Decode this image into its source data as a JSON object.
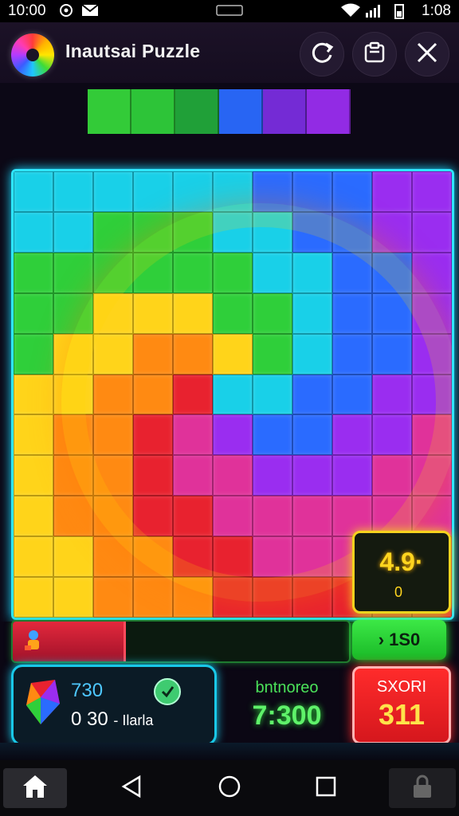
{
  "status_bar": {
    "time_left": "10:00",
    "time_right": "1:08"
  },
  "app": {
    "title": "Inautsai Puzzle"
  },
  "stats": {
    "score_card_value": "4.9·",
    "score_card_sub": "0",
    "progress_fraction": 0.33,
    "next_button_label": "› 1S0",
    "info_top": "730",
    "info_bottom_value": "0 30",
    "info_bottom_label": "- Ilarla",
    "mid_label": "bntnoreo",
    "mid_value": "7:300",
    "score_box_label": "SXORI",
    "score_box_value": "311"
  },
  "palette": {
    "red": "#e8222f",
    "orange": "#ff8a12",
    "yellow": "#ffd41a",
    "green": "#2fcf3a",
    "cyan": "#19d0e8",
    "blue": "#2a6bff",
    "purple": "#9a2df0",
    "magenta": "#e0329a",
    "board_border": "#2ee6ff",
    "next_green": "#3ce846",
    "score_red": "#ff2b2b"
  },
  "icons": {
    "wifi": "wifi-icon",
    "battery": "battery-icon",
    "refresh": "refresh-icon",
    "clipboard": "clipboard-icon",
    "close": "close-icon",
    "home": "home-icon",
    "back": "back-icon",
    "circle_home": "circle-icon",
    "recents": "square-icon",
    "lock": "lock-icon"
  }
}
